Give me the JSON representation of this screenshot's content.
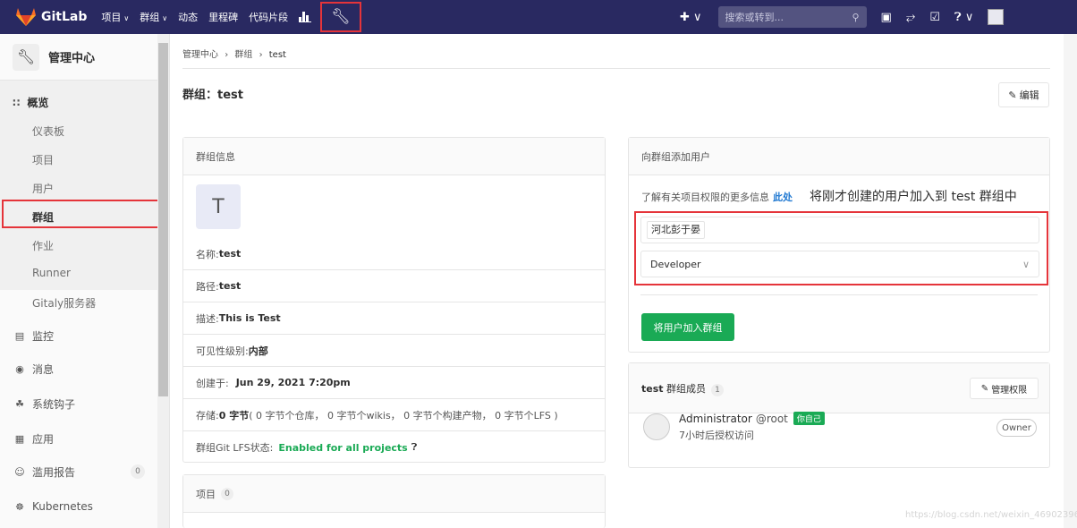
{
  "topbar": {
    "brand": "GitLab",
    "nav": [
      {
        "label": "项目",
        "caret": "∨"
      },
      {
        "label": "群组",
        "caret": "∨"
      },
      {
        "label": "动态",
        "caret": ""
      },
      {
        "label": "里程碑",
        "caret": ""
      },
      {
        "label": "代码片段",
        "caret": ""
      }
    ],
    "search_placeholder": "搜索或转到...",
    "icons": [
      "chart-icon",
      "wrench-icon",
      "plus-icon",
      "search-icon",
      "issues-icon",
      "merge-request-icon",
      "todo-icon",
      "help-icon",
      "user-avatar"
    ]
  },
  "sidebar": {
    "title": "管理中心",
    "overview": "概览",
    "sub_items": [
      "仪表板",
      "项目",
      "用户",
      "群组",
      "作业",
      "Runner",
      "Gitaly服务器"
    ],
    "items": [
      "监控",
      "消息",
      "系统钩子",
      "应用",
      "滥用报告",
      "Kubernetes"
    ],
    "abuse_count": "0"
  },
  "breadcrumb": {
    "a": "管理中心",
    "b": "群组",
    "c": "test",
    "sep": "›"
  },
  "page": {
    "title": "群组：test",
    "edit_label": "编辑"
  },
  "group_info": {
    "header": "群组信息",
    "avatar_letter": "T",
    "name_label": "名称: ",
    "name": "test",
    "path_label": "路径: ",
    "path": "test",
    "desc_label": "描述: ",
    "desc": "This is Test",
    "visibility_label": "可见性级别: ",
    "visibility": "内部",
    "created_label": "创建于:",
    "created": "Jun 29, 2021 7:20pm",
    "storage_label": "存储: ",
    "storage_value": "0 字节",
    "storage_detail": " ( 0 字节个仓库， 0 字节个wikis， 0 字节个构建产物， 0 字节个LFS )",
    "lfs_label": "群组Git LFS状态: ",
    "lfs_value": "Enabled for all projects"
  },
  "projects": {
    "header": "项目",
    "count": "0"
  },
  "add_user": {
    "header": "向群组添加用户",
    "help": "了解有关项目权限的更多信息",
    "link": "此处",
    "annotation": "将刚才创建的用户加入到 test 群组中",
    "selected_user": "河北彭于晏",
    "role": "Developer",
    "button": "将用户加入群组"
  },
  "members": {
    "group": "test",
    "label": "群组成员",
    "count": "1",
    "manage": "管理权限",
    "member": {
      "name": "Administrator",
      "handle": "@root",
      "badge": "你自己",
      "sub": "7小时后授权访问",
      "role": "Owner"
    }
  },
  "watermark": "https://blog.csdn.net/weixin_46902396",
  "colors": {
    "topbar": "#292961",
    "accent_green": "#1aaa55",
    "highlight_red": "#e5343a",
    "link": "#1f78d1"
  }
}
